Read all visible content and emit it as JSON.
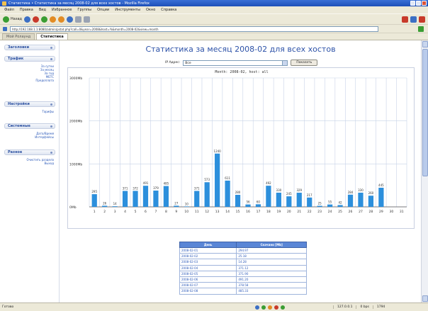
{
  "window": {
    "title": "Статистика • Статистика за месяц 2008-02 для всех хостов - Mozilla Firefox"
  },
  "menu": [
    "Файл",
    "Правка",
    "Вид",
    "Избранное",
    "Группы",
    "Опции",
    "Инструменты",
    "Окно",
    "Справка"
  ],
  "toolbar": {
    "back_label": "Назад",
    "forward_label": "",
    "stop_label": "",
    "refresh_label": "",
    "home_label": ""
  },
  "address": {
    "url": "http://192.168.1.1:8080/admin/pstat.php?call=0&year=2008&host=%&month=2008-02&view=month"
  },
  "tabs": [
    {
      "label": "Мой Ролаунд",
      "active": false
    },
    {
      "label": "Статистика",
      "active": true
    }
  ],
  "sidebar": {
    "sections": [
      {
        "title": "Заголовки",
        "links": []
      },
      {
        "title": "Трафик",
        "links": [
          "За сутки",
          "За месяц",
          "За год",
          "МЕТС",
          "Предоплата"
        ]
      },
      {
        "title": "Настройки",
        "links": [
          "Тарифы"
        ]
      },
      {
        "title": "Системные",
        "links": [
          "Дата/Время",
          "Интерфейсы"
        ]
      },
      {
        "title": "Разное",
        "links": [
          "Очистить раздела",
          "Выход"
        ]
      }
    ]
  },
  "main": {
    "title": "Статистика за месяц 2008-02 для всех хостов",
    "ip_label": "IP Адрес:",
    "ip_value": "Все",
    "show_button": "Показать"
  },
  "chart_data": {
    "type": "bar",
    "title": "Month: 2008-02, host: all",
    "ylabel": "",
    "xlabel": "",
    "y_ticks": [
      "3000Mb",
      "2000Mb",
      "1000Mb",
      "0Mb"
    ],
    "ylim": [
      0,
      3000
    ],
    "categories": [
      "1",
      "2",
      "3",
      "4",
      "5",
      "6",
      "7",
      "8",
      "9",
      "10",
      "11",
      "12",
      "13",
      "14",
      "15",
      "16",
      "17",
      "18",
      "19",
      "20",
      "21",
      "22",
      "23",
      "24",
      "25",
      "26",
      "27",
      "28",
      "29",
      "30",
      "31"
    ],
    "values": [
      295,
      26,
      14,
      371,
      372,
      491,
      379,
      485,
      27,
      10,
      371,
      573,
      1240,
      611,
      280,
      56,
      60,
      492,
      330,
      245,
      329,
      217,
      25,
      55,
      42,
      284,
      330,
      260,
      445,
      0,
      0
    ],
    "data_labels": [
      "295",
      "26",
      "14",
      "371",
      "372",
      "491",
      "379",
      "485",
      "27",
      "10",
      "371",
      "573",
      "1240",
      "611",
      "280",
      "56",
      "60",
      "492",
      "330",
      "245",
      "329",
      "217",
      "25",
      "55",
      "42",
      "284",
      "330",
      "260",
      "445",
      "",
      ""
    ],
    "grid": true,
    "bar_color": "#2c8fdc"
  },
  "table": {
    "headers": [
      "День",
      "Скачано [Mb]"
    ],
    "rows": [
      [
        "2008-02-01",
        "294.97"
      ],
      [
        "2008-02-02",
        "25.18"
      ],
      [
        "2008-02-03",
        "14.28"
      ],
      [
        "2008-02-04",
        "371.12"
      ],
      [
        "2008-02-05",
        "371.90"
      ],
      [
        "2008-02-06",
        "491.20"
      ],
      [
        "2008-02-07",
        "378.58"
      ],
      [
        "2008-02-08",
        "485.33"
      ]
    ]
  },
  "status": {
    "left": "Готово",
    "ip": "127.0.0.1",
    "seg2": "0 bps",
    "seg3": "1794"
  }
}
